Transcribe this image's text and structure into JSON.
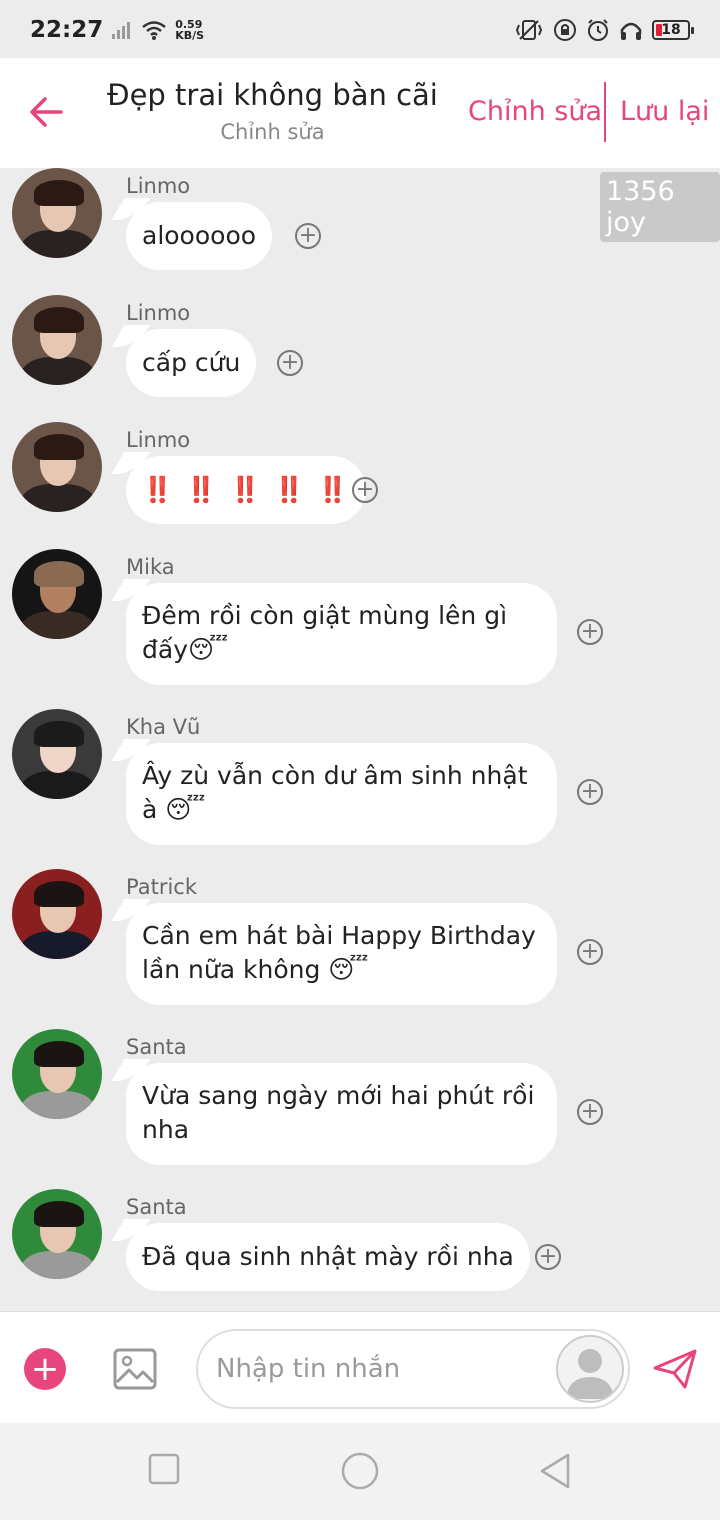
{
  "status_bar": {
    "time": "22:27",
    "net_speed_value": "0.59",
    "net_speed_unit": "KB/S",
    "battery": "18"
  },
  "header": {
    "title": "Đẹp trai không bàn cãi",
    "subtitle": "Chỉnh sửa",
    "edit_label": "Chỉnh sửa",
    "save_label": "Lưu lại"
  },
  "joy_badge": "1356 joy",
  "messages": [
    {
      "sender": "Linmo",
      "text": "aloooooo"
    },
    {
      "sender": "Linmo",
      "text": "cấp cứu"
    },
    {
      "sender": "Linmo",
      "text": "‼️ ‼️ ‼️ ‼️ ‼️"
    },
    {
      "sender": "Mika",
      "text": "Đêm rồi còn giật mùng lên gì đấy😴"
    },
    {
      "sender": "Kha Vũ",
      "text": "Ây zù vẫn còn dư âm sinh nhật à 😴"
    },
    {
      "sender": "Patrick",
      "text": "Cần em hát bài Happy Birthday lần nữa không 😴"
    },
    {
      "sender": "Santa",
      "text": "Vừa sang ngày mới hai phút rồi nha"
    },
    {
      "sender": "Santa",
      "text": "Đã qua sinh nhật mày rồi nha"
    }
  ],
  "input": {
    "placeholder": "Nhập tin nhắn",
    "value": ""
  },
  "colors": {
    "accent": "#e8457f",
    "background": "#ececec",
    "bubble": "#ffffff"
  },
  "icons": {
    "back": "arrow-left-icon",
    "add_message": "circle-plus-icon",
    "add": "plus-icon",
    "image": "image-icon",
    "send": "send-icon",
    "nav_recents": "square-icon",
    "nav_home": "circle-icon",
    "nav_back": "triangle-back-icon"
  }
}
